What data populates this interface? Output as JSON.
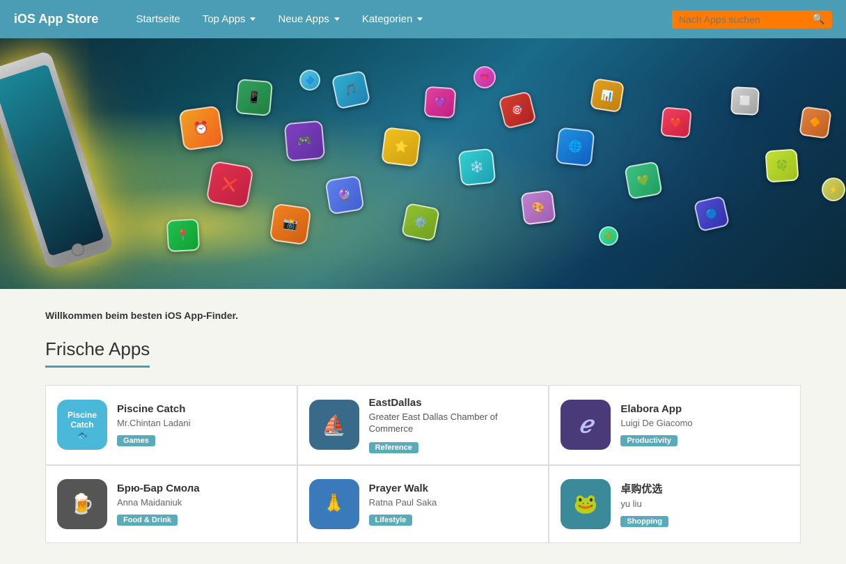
{
  "navbar": {
    "brand": "iOS App Store",
    "links": [
      {
        "label": "Startseite",
        "hasDropdown": false
      },
      {
        "label": "Top Apps",
        "hasDropdown": true
      },
      {
        "label": "Neue Apps",
        "hasDropdown": true
      },
      {
        "label": "Kategorien",
        "hasDropdown": true
      }
    ],
    "search": {
      "placeholder": "Nach Apps suchen"
    }
  },
  "welcome": {
    "text": "Willkommen beim besten iOS App-Finder."
  },
  "section": {
    "title": "Frische Apps"
  },
  "apps": [
    {
      "id": "piscine-catch",
      "name": "Piscine Catch",
      "author": "Mr.Chintan Ladani",
      "description": "",
      "tag": "Games",
      "tagClass": "tag-games",
      "iconClass": "icon-piscine",
      "iconText": "Piscine\nCatch"
    },
    {
      "id": "eastdallas",
      "name": "EastDallas",
      "author": "Greater East Dallas Chamber of Commerce",
      "description": "",
      "tag": "Reference",
      "tagClass": "tag-reference",
      "iconClass": "icon-eastdallas",
      "iconText": "⛵"
    },
    {
      "id": "elabora",
      "name": "Elabora App",
      "author": "Luigi De Giacomo",
      "description": "",
      "tag": "Productivity",
      "tagClass": "tag-productivity",
      "iconClass": "icon-elabora",
      "iconText": "ℯ"
    },
    {
      "id": "bryu-bar",
      "name": "Брю-Бар Смола",
      "author": "Anna Maidaniuk",
      "description": "",
      "tag": "Food & Drink",
      "tagClass": "tag-food",
      "iconClass": "icon-bryu",
      "iconText": "🍺"
    },
    {
      "id": "prayer-walk",
      "name": "Prayer Walk",
      "author": "Ratna Paul Saka",
      "description": "",
      "tag": "Lifestyle",
      "tagClass": "tag-lifestyle",
      "iconClass": "icon-prayer",
      "iconText": "🙏"
    },
    {
      "id": "zhuo-gou",
      "name": "卓购优选",
      "author": "yu liu",
      "description": "",
      "tag": "Shopping",
      "tagClass": "tag-shopping",
      "iconClass": "icon-shop",
      "iconText": "🐸"
    }
  ]
}
